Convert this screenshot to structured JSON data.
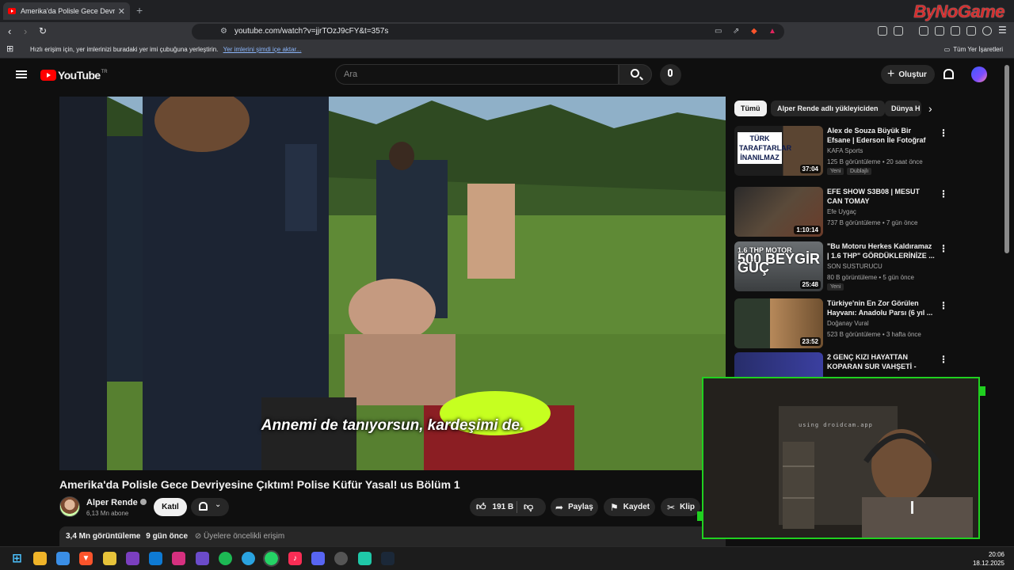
{
  "browser": {
    "tab_title": "Amerika'da Polisle Gece Devriyes",
    "tab_close": "✕",
    "new_tab": "+",
    "watermark": "ByNoGame",
    "url": "youtube.com/watch?v=jjrTOzJ9cFY&t=357s",
    "bookmarks_hint": "Hızlı erişim için, yer imlerinizi buradaki yer imi çubuğuna yerleştirin.",
    "bookmarks_import_link": "Yer imlerini şimdi içe aktar...",
    "bookmarks_all": "Tüm Yer İşaretleri"
  },
  "youtube": {
    "logo_text": "YouTube",
    "logo_country": "TR",
    "search_placeholder": "Ara",
    "create_label": "Oluştur"
  },
  "video": {
    "subtitle": "Annemi de tanıyorsun, kardeşimi de.",
    "title": "Amerika'da Polisle Gece Devriyesine Çıktım! Polise Küfür Yasal! us Bölüm 1",
    "channel_name": "Alper Rende",
    "subscribers": "6,13 Mn abone",
    "join_label": "Katıl",
    "likes": "191 B",
    "share_label": "Paylaş",
    "save_label": "Kaydet",
    "clip_label": "Klip",
    "views": "3,4 Mn görüntüleme",
    "published": "9 gün önce",
    "members_note": "⊘ Üyelere öncelikli erişim"
  },
  "chips": [
    "Tümü",
    "Alper Rende adlı yükleyiciden",
    "Dünya H"
  ],
  "recommendations": [
    {
      "title": "Alex de Souza Büyük Bir Efsane | Ederson İle Fotoğraf Albümü",
      "channel": "KAFA Sports",
      "meta": "125 B görüntüleme • 20 saat önce",
      "duration": "37:04",
      "badges": [
        "Yeni",
        "Dublajlı"
      ],
      "thumb_text": "TÜRK TARAFTARLAR İNANILMAZ"
    },
    {
      "title": "EFE SHOW S3B08 | MESUT CAN TOMAY",
      "channel": "Efe Uygaç",
      "meta": "737 B görüntüleme • 7 gün önce",
      "duration": "1:10:14"
    },
    {
      "title": "\"Bu Motoru Herkes Kaldıramaz | 1.6 THP\" GÖRDÜKLERİNİZE ...",
      "channel": "SON SUSTURUCU",
      "meta": "80 B görüntüleme • 5 gün önce",
      "duration": "25:48",
      "badges": [
        "Yeni"
      ],
      "thumb_line1": "1.6 THP MOTOR",
      "thumb_line2": "500 BEYGİR",
      "thumb_line3": "GÜÇ"
    },
    {
      "title": "Türkiye'nin En Zor Görülen Hayvanı: Anadolu Parsı (6 yıl ...",
      "channel": "Doğanay Vural",
      "meta": "523 B görüntüleme • 3 hafta önce",
      "duration": "23:52"
    },
    {
      "title": "2 GENÇ KIZI HAYATTAN KOPARAN SUR VAHŞETİ -",
      "channel": "",
      "meta": "",
      "duration": ""
    }
  ],
  "webcam": {
    "overlay_text": "using droidcam.app"
  },
  "taskbar": {
    "time": "20:06",
    "date": "18.12.2025"
  },
  "colors": {
    "accent_red": "#ff0000",
    "webcam_border": "#20d020"
  }
}
